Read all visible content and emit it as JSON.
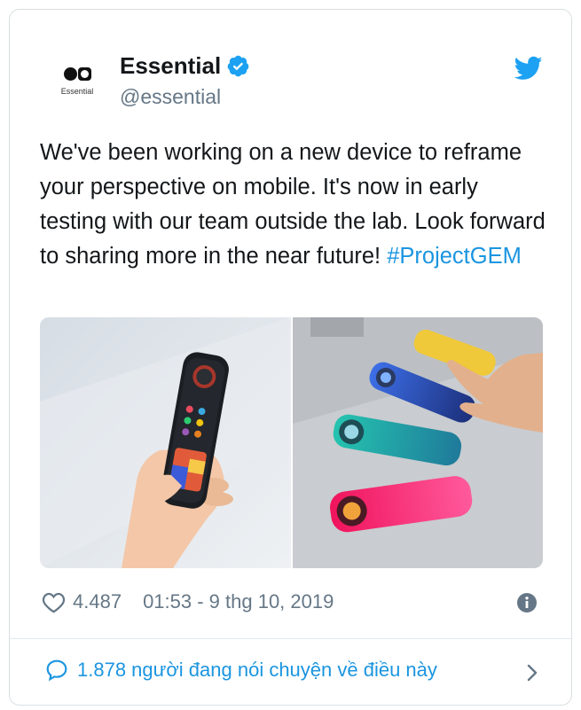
{
  "account": {
    "name": "Essential",
    "handle": "@essential",
    "logo_text": "Essential",
    "verified": true
  },
  "tweet": {
    "text": "We've been working on a new device to reframe your perspective on mobile. It's now in early testing with our team outside the lab. Look forward to sharing more in the near future! ",
    "hashtag": "#ProjectGEM"
  },
  "media": {
    "count": 2
  },
  "footer": {
    "likes": "4.487",
    "timestamp": "01:53 - 9 thg 10, 2019"
  },
  "conversation": {
    "label": "1.878 người đang nói chuyện về điều này"
  },
  "colors": {
    "accent": "#1b95e0",
    "text": "#14171a",
    "muted": "#657786"
  },
  "icons": [
    "verified-icon",
    "twitter-bird-icon",
    "heart-icon",
    "info-icon",
    "reply-bubble-icon",
    "chevron-right-icon"
  ]
}
